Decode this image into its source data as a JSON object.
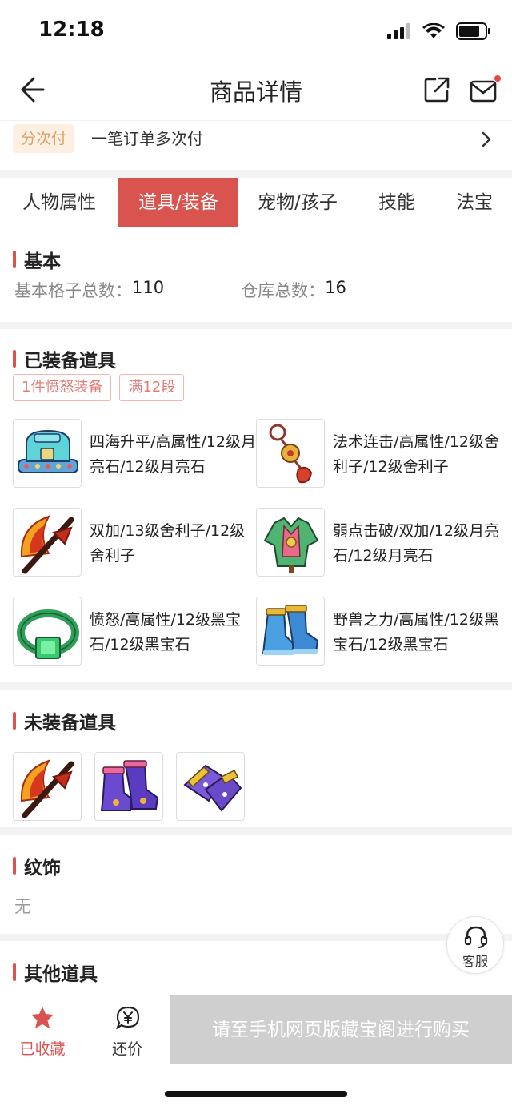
{
  "status_bar": {
    "time": "12:18"
  },
  "nav": {
    "title": "商品详情"
  },
  "installment": {
    "tag": "分次付",
    "text": "一笔订单多次付"
  },
  "tabs": [
    {
      "label": "人物属性",
      "active": false
    },
    {
      "label": "道具/装备",
      "active": true
    },
    {
      "label": "宠物/孩子",
      "active": false
    },
    {
      "label": "技能",
      "active": false
    },
    {
      "label": "法宝",
      "active": false
    }
  ],
  "basic": {
    "title": "基本",
    "grid_label": "基本格子总数：",
    "grid_value": "110",
    "warehouse_label": "仓库总数：",
    "warehouse_value": "16"
  },
  "equipped": {
    "title": "已装备道具",
    "tags": [
      "1件愤怒装备",
      "满12段"
    ],
    "items": [
      {
        "icon": "helmet-icon",
        "text": "四海升平/高属性/12级月亮石/12级月亮石"
      },
      {
        "icon": "necklace-icon",
        "text": "法术连击/高属性/12级舍利子/12级舍利子"
      },
      {
        "icon": "weapon-axe-icon",
        "text": "双加/13级舍利子/12级舍利子"
      },
      {
        "icon": "armor-icon",
        "text": "弱点击破/双加/12级月亮石/12级月亮石"
      },
      {
        "icon": "belt-icon",
        "text": "愤怒/高属性/12级黑宝石/12级黑宝石"
      },
      {
        "icon": "boots-icon",
        "text": "野兽之力/高属性/12级黑宝石/12级黑宝石"
      }
    ]
  },
  "unequipped": {
    "title": "未装备道具",
    "items": [
      "weapon-axe-icon",
      "boots-icon",
      "gauntlet-icon"
    ]
  },
  "pattern": {
    "title": "纹饰",
    "value": "无"
  },
  "other": {
    "title": "其他道具"
  },
  "customer_service": {
    "label": "客服"
  },
  "bottom_bar": {
    "favorite_label": "已收藏",
    "bargain_label": "还价",
    "buy_label": "请至手机网页版藏宝阁进行购买"
  },
  "colors": {
    "accent": "#d9534f",
    "buy_disabled": "#cfcfcf",
    "tag_orange": "#d9a36a"
  }
}
